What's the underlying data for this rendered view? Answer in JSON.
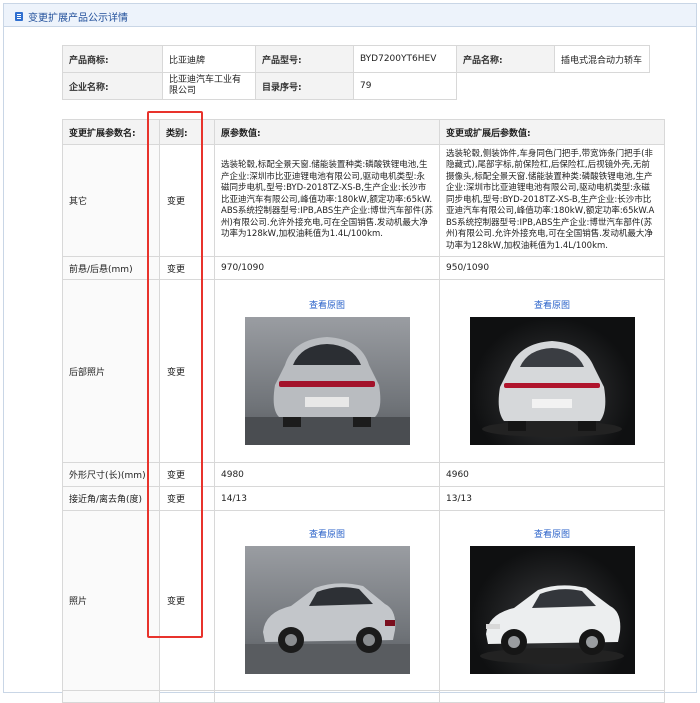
{
  "header": {
    "title": "变更扩展产品公示详情"
  },
  "info": {
    "brand_label": "产品商标:",
    "brand_value": "比亚迪牌",
    "model_label": "产品型号:",
    "model_value": "BYD7200YT6HEV",
    "name_label": "产品名称:",
    "name_value": "插电式混合动力轿车",
    "company_label": "企业名称:",
    "company_value": "比亚迪汽车工业有限公司",
    "catalog_label": "目录序号:",
    "catalog_value": "79"
  },
  "table": {
    "headers": [
      "变更扩展参数名:",
      "类别:",
      "原参数值:",
      "变更或扩展后参数值:"
    ],
    "rows": [
      {
        "name": "其它",
        "category": "变更",
        "original": "选装轮毂,标配全景天窗.储能装置种类:磷酸铁锂电池,生产企业:深圳市比亚迪锂电池有限公司,驱动电机类型:永磁同步电机,型号:BYD-2018TZ-XS-B,生产企业:长沙市比亚迪汽车有限公司,峰值功率:180kW,额定功率:65kW.ABS系统控制器型号:IPB,ABS生产企业:博世汽车部件(苏州)有限公司.允许外接充电,可在全国销售.发动机最大净功率为128kW,加权油耗值为1.4L/100km.",
        "changed": "选装轮毂,侧装饰件,车身同色门把手,带宽饰条门把手(非隐藏式),尾部字标,前保险杠,后保险杠,后视镜外壳,无前摄像头,标配全景天窗.储能装置种类:磷酸铁锂电池,生产企业:深圳市比亚迪锂电池有限公司,驱动电机类型:永磁同步电机,型号:BYD-2018TZ-XS-B,生产企业:长沙市比亚迪汽车有限公司,峰值功率:180kW,额定功率:65kW.ABS系统控制器型号:IPB,ABS生产企业:博世汽车部件(苏州)有限公司.允许外接充电,可在全国销售.发动机最大净功率为128kW,加权油耗值为1.4L/100km."
      },
      {
        "name": "前悬/后悬(mm)",
        "category": "变更",
        "original": "970/1090",
        "changed": "950/1090"
      },
      {
        "name": "后部照片",
        "category": "变更",
        "link_original": "查看原图",
        "link_changed": "查看原图"
      },
      {
        "name": "外形尺寸(长)(mm)",
        "category": "变更",
        "original": "4980",
        "changed": "4960"
      },
      {
        "name": "接近角/离去角(度)",
        "category": "变更",
        "original": "14/13",
        "changed": "13/13"
      },
      {
        "name": "照片",
        "category": "变更",
        "link_original": "查看原图",
        "link_changed": "查看原图"
      }
    ]
  },
  "colors": {
    "highlight": "#e8332c",
    "link": "#2a62c9",
    "header_bg": "#edf3fb"
  },
  "icons": {
    "title": "document-icon"
  }
}
